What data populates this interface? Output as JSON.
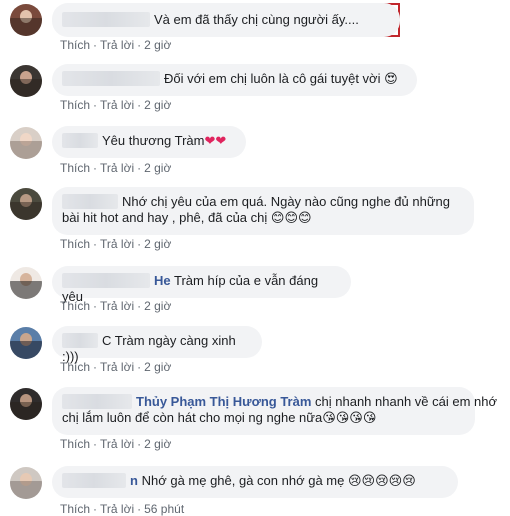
{
  "comments": [
    {
      "name": "",
      "text": "Và em đã thấy chị cùng người ấy....",
      "emoji": "",
      "like": "Thích",
      "reply": "Trả lời",
      "time": "2 giờ"
    },
    {
      "name": "",
      "text": "Đối với em chị luôn là cô gái tuyệt vời",
      "emoji": "😍",
      "like": "Thích",
      "reply": "Trả lời",
      "time": "2 giờ"
    },
    {
      "name": "",
      "text": "Yêu thương Tràm",
      "emoji": "❤❤",
      "like": "Thích",
      "reply": "Trả lời",
      "time": "2 giờ"
    },
    {
      "name": "",
      "text_line1": "Nhớ chị yêu của em quá. Ngày nào cũng nghe đủ những",
      "text_line2": "bài hit hot and hay , phê, đã của chị",
      "emoji": "😊😊😊",
      "like": "Thích",
      "reply": "Trả lời",
      "time": "2 giờ"
    },
    {
      "name": "He",
      "text": "Tràm híp của e vẫn đáng yêu",
      "emoji": "",
      "like": "Thích",
      "reply": "Trả lời",
      "time": "2 giờ"
    },
    {
      "name": "",
      "text": "C Tràm ngày càng xinh :)))",
      "emoji": "",
      "like": "Thích",
      "reply": "Trả lời",
      "time": "2 giờ"
    },
    {
      "name": "Thủy Phạm Thị Hương Tràm",
      "text_line1": "chị nhanh nhanh về cái em nhớ",
      "text_line2": "chị lắm luôn để còn hát cho mọi ng nghe nữa",
      "emoji": "😘😘😘😘",
      "like": "Thích",
      "reply": "Trả lời",
      "time": "2 giờ"
    },
    {
      "name": "n",
      "text": "Nhớ gà mẹ ghê, gà con nhớ gà mẹ",
      "emoji": "😢😢😢😢😢",
      "like": "Thích",
      "reply": "Trả lời",
      "time": "56 phút"
    }
  ],
  "colors": {
    "highlight": "#c1272d",
    "bubble": "#f2f3f5",
    "meta": "#606770",
    "name": "#385898"
  }
}
